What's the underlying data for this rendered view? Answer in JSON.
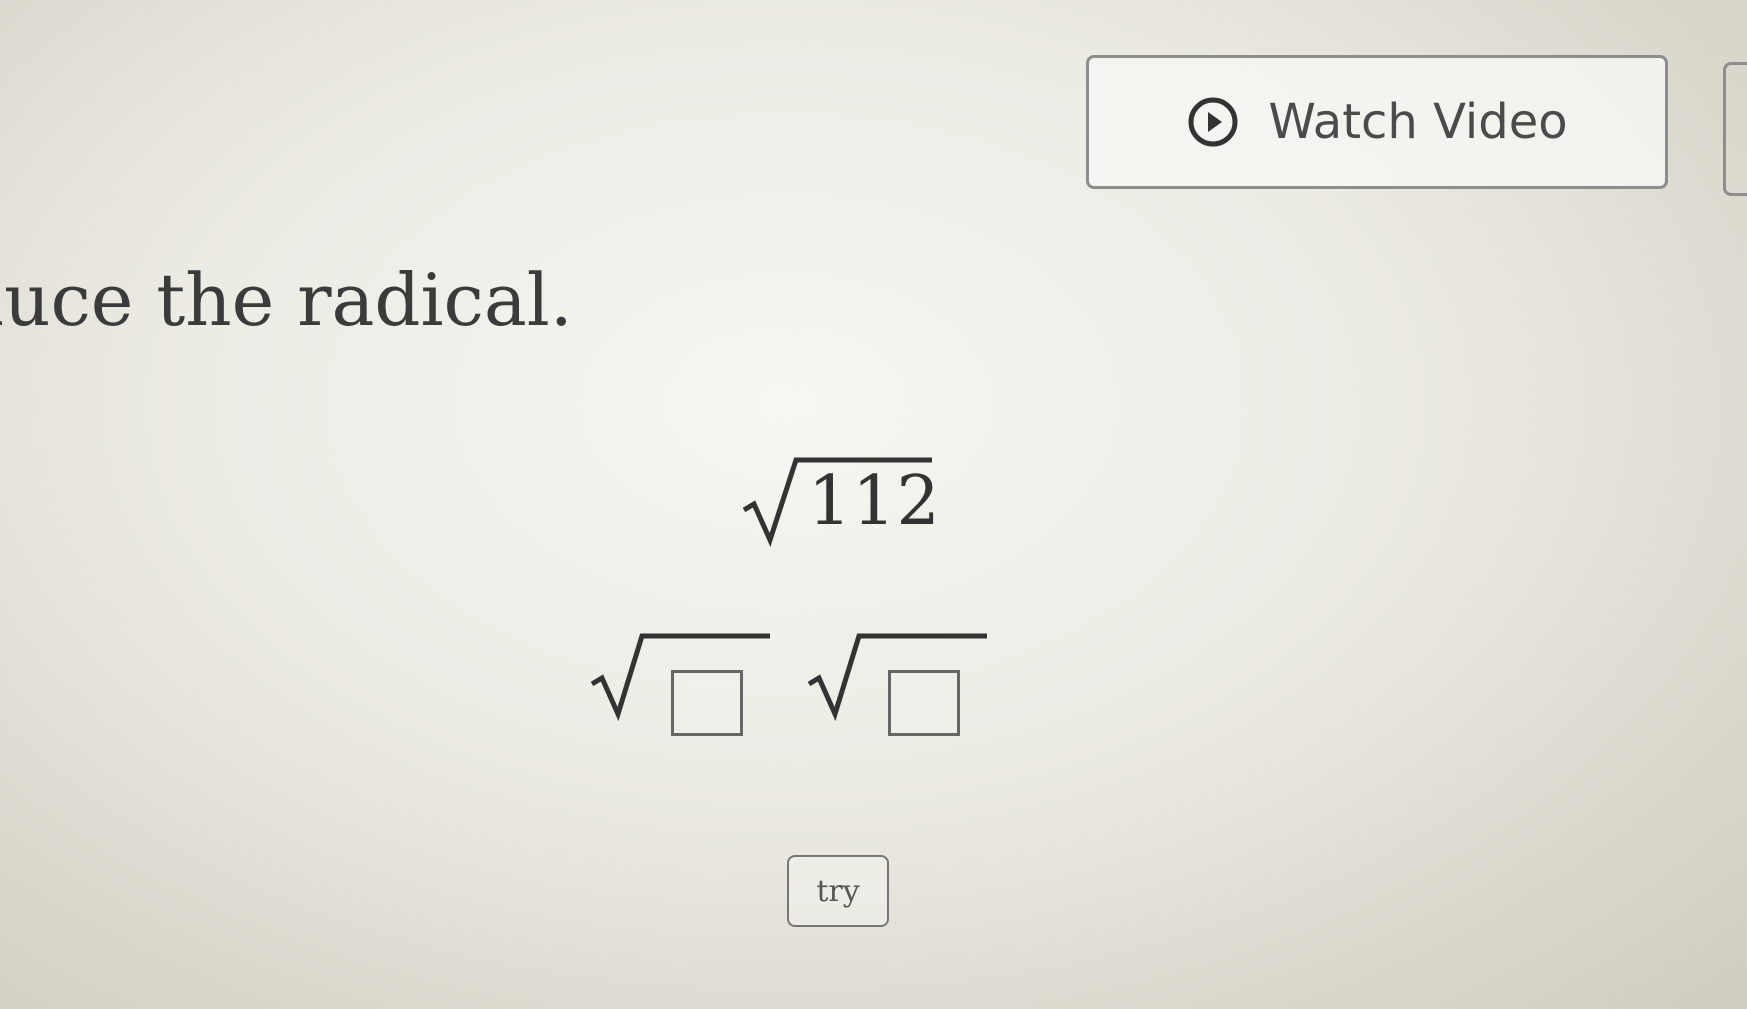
{
  "header": {
    "watch_video_label": "Watch Video",
    "watch_video_icon": "play-circle-icon"
  },
  "problem": {
    "prompt": "duce the radical.",
    "radicand": "112"
  },
  "answer": {
    "slots": [
      "",
      ""
    ]
  },
  "actions": {
    "try_label": "try"
  }
}
